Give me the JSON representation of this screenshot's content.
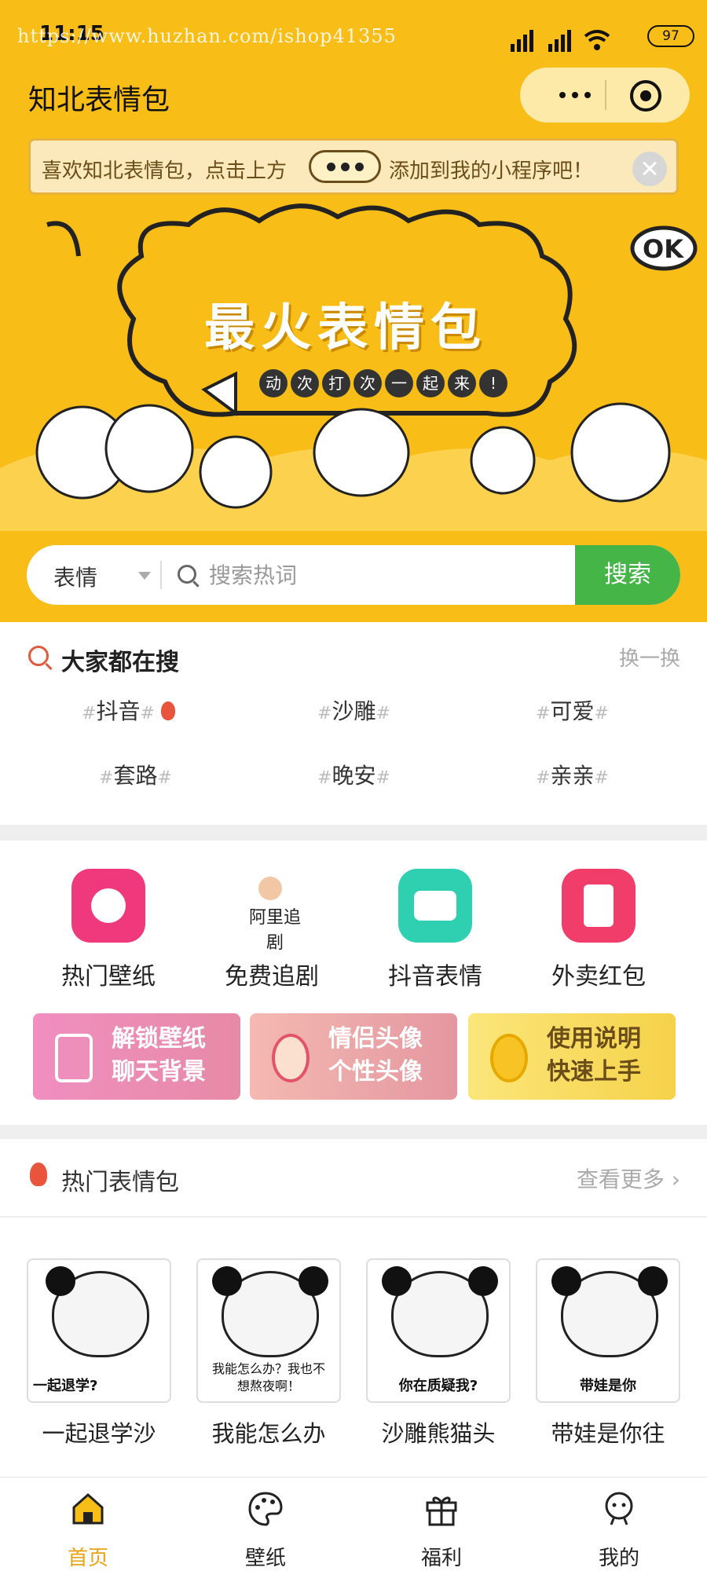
{
  "status": {
    "time": "11:15",
    "url": "https://www.huzhan.com/ishop41355",
    "battery": "97"
  },
  "header": {
    "title": "知北表情包"
  },
  "tip": {
    "text_before": "喜欢知北表情包，点击上方",
    "text_after": "添加到我的小程序吧！"
  },
  "banner": {
    "title": "最火表情包",
    "subtitle_chars": [
      "动",
      "次",
      "打",
      "次",
      "一",
      "起",
      "来",
      "!"
    ]
  },
  "search": {
    "category": "表情",
    "placeholder": "搜索热词",
    "button": "搜索"
  },
  "hot_search": {
    "title": "大家都在搜",
    "refresh": "换一换",
    "tags": [
      "抖音",
      "沙雕",
      "可爱",
      "套路",
      "晚安",
      "亲亲"
    ]
  },
  "quick": {
    "items": [
      {
        "label": "热门壁纸",
        "color": "#f0397c"
      },
      {
        "label": "免费追剧",
        "logo": "阿里追剧"
      },
      {
        "label": "抖音表情",
        "color": "#2fd0b2"
      },
      {
        "label": "外卖红包",
        "color": "#f03d6a"
      }
    ],
    "cards": [
      {
        "line1": "解锁壁纸",
        "line2": "聊天背景",
        "color": "#e98bb5"
      },
      {
        "line1": "情侣头像",
        "line2": "个性头像",
        "color": "#e9a1a8"
      },
      {
        "line1": "使用说明",
        "line2": "快速上手",
        "color": "#f7d95a"
      }
    ]
  },
  "hot_pack": {
    "title": "热门表情包",
    "more": "查看更多",
    "items": [
      {
        "caption": "一起退学?",
        "name": "一起退学沙"
      },
      {
        "caption": "我能怎么办？我也不想熬夜啊！",
        "name": "我能怎么办"
      },
      {
        "caption": "你在质疑我?",
        "name": "沙雕熊猫头"
      },
      {
        "caption": "带娃是你",
        "name": "带娃是你往"
      }
    ]
  },
  "nav": {
    "items": [
      "首页",
      "壁纸",
      "福利",
      "我的"
    ],
    "active_color": "#e8a316"
  }
}
